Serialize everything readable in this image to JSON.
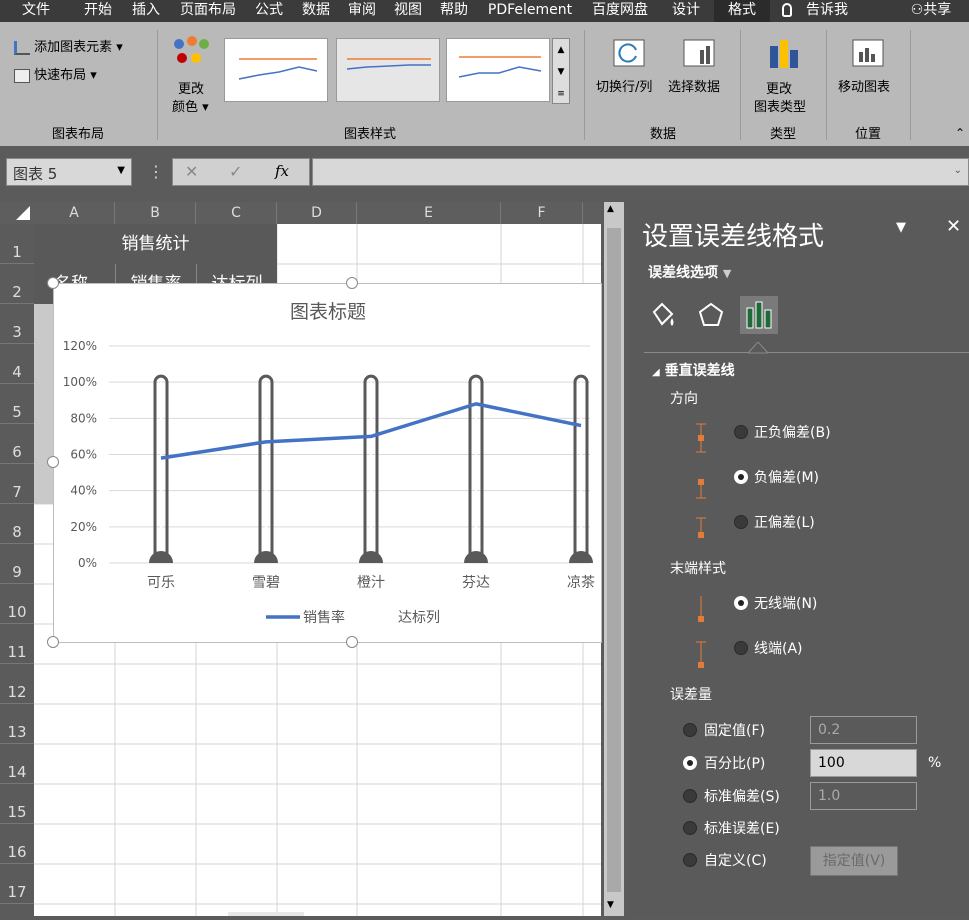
{
  "tabs": [
    "文件",
    "开始",
    "插入",
    "页面布局",
    "公式",
    "数据",
    "审阅",
    "视图",
    "帮助",
    "PDFelement",
    "百度网盘",
    "设计",
    "格式",
    "告诉我",
    "共享"
  ],
  "ribbon": {
    "add_chart_element": "添加图表元素",
    "quick_layout": "快速布局",
    "group_layout": "图表布局",
    "change_color_1": "更改",
    "change_color_2": "颜色",
    "group_styles": "图表样式",
    "switch_row_col": "切换行/列",
    "select_data": "选择数据",
    "group_data": "数据",
    "change_type_1": "更改",
    "change_type_2": "图表类型",
    "group_type": "类型",
    "move_chart": "移动图表",
    "group_position": "位置"
  },
  "formula_bar": {
    "name_box": "图表 5",
    "fx": "fx"
  },
  "sheet": {
    "columns": [
      "A",
      "B",
      "C",
      "D",
      "E",
      "F"
    ],
    "rows": [
      "1",
      "2",
      "3",
      "4",
      "5",
      "6",
      "7",
      "8",
      "9",
      "10",
      "11",
      "12",
      "13",
      "14",
      "15",
      "16",
      "17"
    ],
    "a1": "销售统计",
    "a2": "名称",
    "b2": "销售率",
    "c2": "达标列"
  },
  "chart_data": {
    "type": "line",
    "title": "图表标题",
    "categories": [
      "可乐",
      "雪碧",
      "橙汁",
      "芬达",
      "凉茶"
    ],
    "series": [
      {
        "name": "销售率",
        "values": [
          0.58,
          0.67,
          0.7,
          0.88,
          0.76
        ],
        "color": "#4472c4"
      },
      {
        "name": "达标列",
        "values": [
          1.0,
          1.0,
          1.0,
          1.0,
          1.0
        ],
        "color": "#595959"
      }
    ],
    "yticks": [
      "0%",
      "20%",
      "40%",
      "60%",
      "80%",
      "100%",
      "120%"
    ],
    "ylim": [
      0,
      1.2
    ],
    "legend_position": "bottom"
  },
  "pane": {
    "title": "设置误差线格式",
    "options_label": "误差线选项",
    "section": "垂直误差线",
    "direction_label": "方向",
    "dir_both": "正负偏差(B)",
    "dir_minus": "负偏差(M)",
    "dir_plus": "正偏差(L)",
    "end_style_label": "末端样式",
    "no_cap": "无线端(N)",
    "cap": "线端(A)",
    "amount_label": "误差量",
    "fixed": "固定值(F)",
    "fixed_value": "0.2",
    "percent": "百分比(P)",
    "percent_value": "100",
    "percent_unit": "%",
    "stddev": "标准偏差(S)",
    "stddev_value": "1.0",
    "stderr": "标准误差(E)",
    "custom": "自定义(C)",
    "specify": "指定值(V)"
  },
  "colors": {
    "accent_orange": "#e07b39",
    "series_blue": "#4472c4",
    "thermo_gray": "#595959"
  }
}
